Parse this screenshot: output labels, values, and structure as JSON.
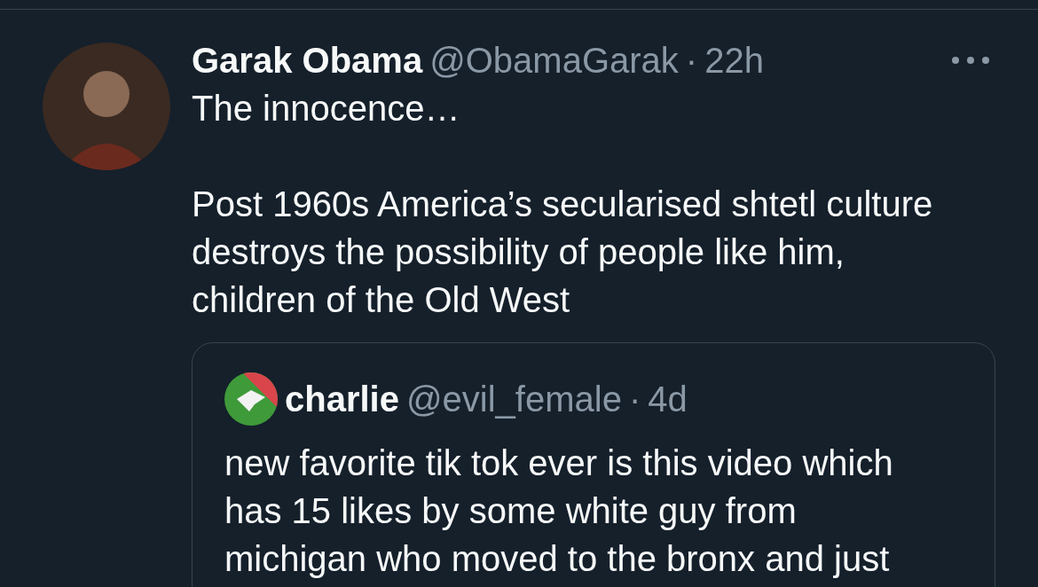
{
  "tweet": {
    "author": {
      "name": "Garak Obama",
      "handle": "@ObamaGarak",
      "separator": "·",
      "time": "22h"
    },
    "paragraphs": [
      [
        "The innocence…"
      ],
      [
        "Post 1960s America’s secularised shtetl culture",
        "destroys the possibility of people like him,",
        "children of the Old West"
      ]
    ],
    "quoted": {
      "author": {
        "name": "charlie",
        "handle": "@evil_female",
        "separator": "·",
        "time": "4d"
      },
      "lines": [
        "new favorite tik tok ever is this video which",
        "has 15 likes by some white guy from",
        "michigan who moved to the bronx and just"
      ]
    }
  }
}
